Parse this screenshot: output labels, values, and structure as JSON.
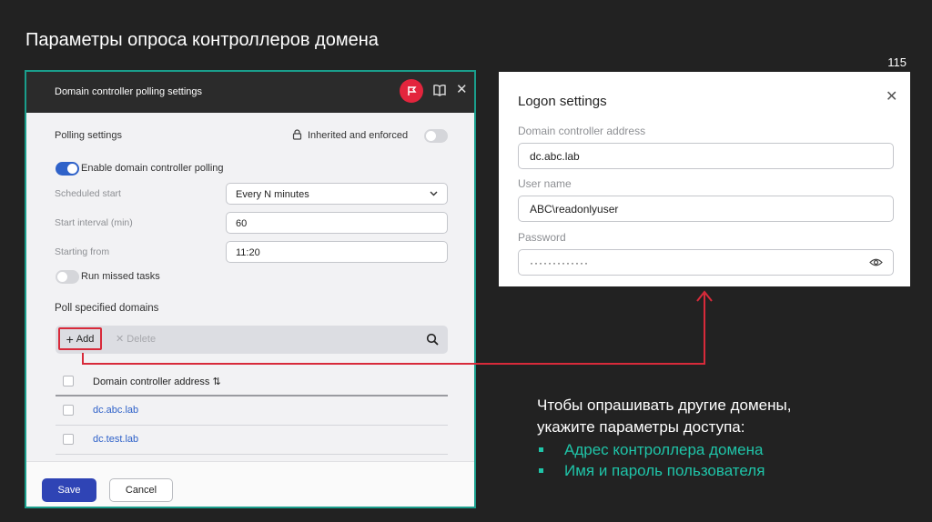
{
  "slide": {
    "title": "Параметры опроса контроллеров домена",
    "page_number": "115"
  },
  "dialog": {
    "title": "Domain controller polling settings",
    "section_title": "Polling settings",
    "lock_label": "Inherited and enforced",
    "enable_polling_label": "Enable domain controller polling",
    "scheduled_start_label": "Scheduled start",
    "scheduled_start_value": "Every N minutes",
    "start_interval_label": "Start interval (min)",
    "start_interval_value": "60",
    "starting_from_label": "Starting from",
    "starting_from_value": "11:20",
    "run_missed_label": "Run missed tasks",
    "poll_domains_title": "Poll specified domains",
    "add_label": "Add",
    "delete_label": "Delete",
    "column_header": "Domain controller address",
    "rows": [
      "dc.abc.lab",
      "dc.test.lab"
    ],
    "save_label": "Save",
    "cancel_label": "Cancel"
  },
  "logon": {
    "title": "Logon settings",
    "dc_label": "Domain controller address",
    "dc_value": "dc.abc.lab",
    "user_label": "User name",
    "user_value": "ABC\\readonlyuser",
    "password_label": "Password",
    "password_value": "·············"
  },
  "note": {
    "line1": "Чтобы опрашивать другие домены,",
    "line2": "укажите параметры доступа:",
    "bullets": [
      "Адрес контроллера домена",
      "Имя и пароль пользователя"
    ]
  },
  "colors": {
    "accent_teal": "#1fc4a8",
    "highlight_red": "#d82a3a",
    "primary_blue": "#2f44b5",
    "link_blue": "#2f62c9"
  }
}
